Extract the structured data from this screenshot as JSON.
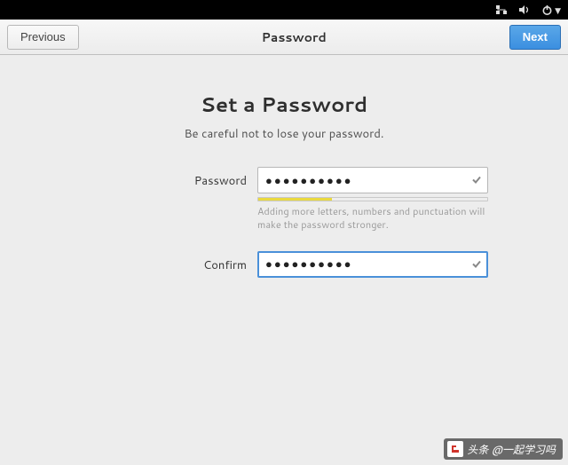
{
  "sysbar": {
    "icons": [
      "network",
      "volume",
      "power"
    ]
  },
  "header": {
    "previous_label": "Previous",
    "title": "Password",
    "next_label": "Next"
  },
  "main": {
    "heading": "Set a Password",
    "subheading": "Be careful not to lose your password.",
    "password_label": "Password",
    "password_value": "●●●●●●●●●●",
    "strength_percent": 32,
    "hint": "Adding more letters, numbers and punctuation will make the password stronger.",
    "confirm_label": "Confirm",
    "confirm_value": "●●●●●●●●●●"
  },
  "watermark": {
    "text": "头条 @一起学习吗"
  }
}
